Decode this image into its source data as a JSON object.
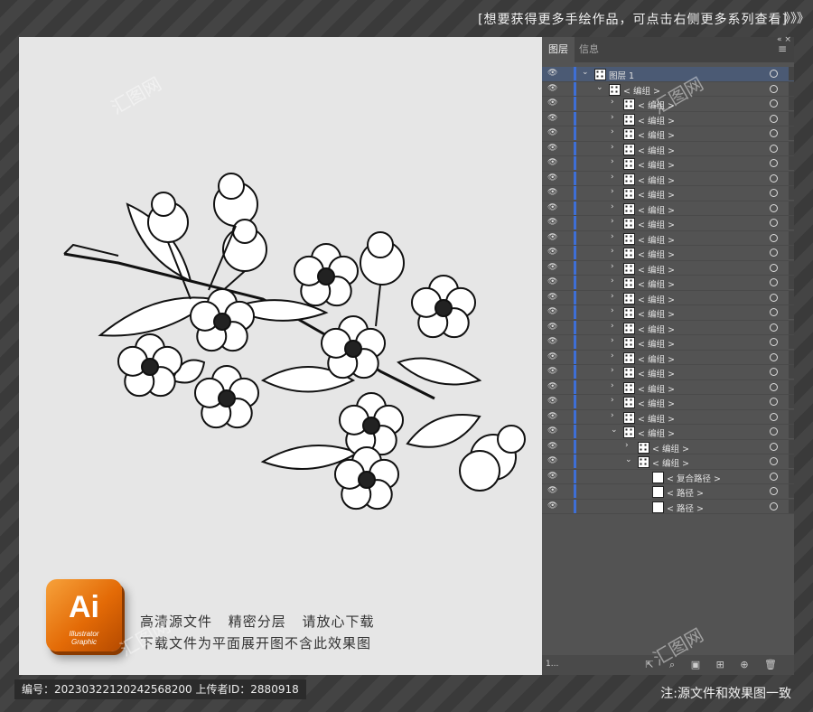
{
  "banner": {
    "text": "[想要获得更多手绘作品，可点击右侧更多系列查看]",
    "arrows": "》》》"
  },
  "canvas": {
    "promo_line1": "高清源文件 精密分层 请放心下载",
    "promo_line2": "下载文件为平面展开图不含此效果图",
    "logo_text": "Ai",
    "logo_sub1": "Illustrator",
    "logo_sub2": "Graphic"
  },
  "panel": {
    "tab_layers": "图层",
    "tab_info": "信息",
    "menu_icon": "≡",
    "collapse_icon": "«  ×",
    "rows": [
      {
        "indent": 0,
        "chev": "⌄",
        "label": "图层 1",
        "thumb": "layer",
        "selected": true
      },
      {
        "indent": 1,
        "chev": "⌄",
        "label": "< 编组 >",
        "thumb": "group"
      },
      {
        "indent": 2,
        "chev": "›",
        "label": "< 编组 >",
        "thumb": "group"
      },
      {
        "indent": 2,
        "chev": "›",
        "label": "< 编组 >",
        "thumb": "group"
      },
      {
        "indent": 2,
        "chev": "›",
        "label": "< 编组 >",
        "thumb": "group"
      },
      {
        "indent": 2,
        "chev": "›",
        "label": "< 编组 >",
        "thumb": "group"
      },
      {
        "indent": 2,
        "chev": "›",
        "label": "< 编组 >",
        "thumb": "group"
      },
      {
        "indent": 2,
        "chev": "›",
        "label": "< 编组 >",
        "thumb": "group"
      },
      {
        "indent": 2,
        "chev": "›",
        "label": "< 编组 >",
        "thumb": "group"
      },
      {
        "indent": 2,
        "chev": "›",
        "label": "< 编组 >",
        "thumb": "group"
      },
      {
        "indent": 2,
        "chev": "›",
        "label": "< 编组 >",
        "thumb": "group"
      },
      {
        "indent": 2,
        "chev": "›",
        "label": "< 编组 >",
        "thumb": "group"
      },
      {
        "indent": 2,
        "chev": "›",
        "label": "< 编组 >",
        "thumb": "group"
      },
      {
        "indent": 2,
        "chev": "›",
        "label": "< 编组 >",
        "thumb": "group"
      },
      {
        "indent": 2,
        "chev": "›",
        "label": "< 编组 >",
        "thumb": "group"
      },
      {
        "indent": 2,
        "chev": "›",
        "label": "< 编组 >",
        "thumb": "group"
      },
      {
        "indent": 2,
        "chev": "›",
        "label": "< 编组 >",
        "thumb": "group"
      },
      {
        "indent": 2,
        "chev": "›",
        "label": "< 编组 >",
        "thumb": "group"
      },
      {
        "indent": 2,
        "chev": "›",
        "label": "< 编组 >",
        "thumb": "group"
      },
      {
        "indent": 2,
        "chev": "›",
        "label": "< 编组 >",
        "thumb": "group"
      },
      {
        "indent": 2,
        "chev": "›",
        "label": "< 编组 >",
        "thumb": "group"
      },
      {
        "indent": 2,
        "chev": "›",
        "label": "< 编组 >",
        "thumb": "group"
      },
      {
        "indent": 2,
        "chev": "›",
        "label": "< 编组 >",
        "thumb": "group"
      },
      {
        "indent": 2,
        "chev": "›",
        "label": "< 编组 >",
        "thumb": "group"
      },
      {
        "indent": 2,
        "chev": "⌄",
        "label": "< 编组 >",
        "thumb": "group"
      },
      {
        "indent": 3,
        "chev": "›",
        "label": "< 编组 >",
        "thumb": "group"
      },
      {
        "indent": 3,
        "chev": "⌄",
        "label": "< 编组 >",
        "thumb": "group"
      },
      {
        "indent": 4,
        "chev": "",
        "label": "< 复合路径 >",
        "thumb": "compound"
      },
      {
        "indent": 4,
        "chev": "",
        "label": "< 路径 >",
        "thumb": "path"
      },
      {
        "indent": 4,
        "chev": "",
        "label": "< 路径 >",
        "thumb": "path"
      }
    ],
    "footer_count": "1...",
    "footer_icons": "⇱ ⌕ ▣ ⊞ ⊕ 🗑"
  },
  "footer": {
    "id_text": "编号：20230322120242568200 上传者ID：2880918",
    "note": "注:源文件和效果图一致"
  },
  "watermark": "汇图网"
}
